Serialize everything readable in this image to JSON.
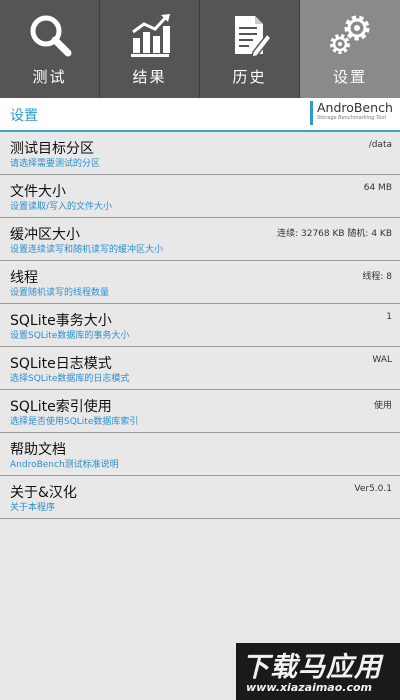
{
  "tabs": [
    {
      "label": "测试",
      "icon": "search-icon"
    },
    {
      "label": "结果",
      "icon": "bar-chart-icon"
    },
    {
      "label": "历史",
      "icon": "document-edit-icon"
    },
    {
      "label": "设置",
      "icon": "gear-icon",
      "active": true
    }
  ],
  "header": {
    "title": "设置",
    "logo_name": "AndroBench",
    "logo_tagline": "Storage Benchmarking Tool"
  },
  "settings": [
    {
      "title": "测试目标分区",
      "subtitle": "请选择需要测试的分区",
      "value": "/data"
    },
    {
      "title": "文件大小",
      "subtitle": "设置读取/写入的文件大小",
      "value": "64 MB"
    },
    {
      "title": "缓冲区大小",
      "subtitle": "设置连续读写和随机读写的缓冲区大小",
      "value": "连续: 32768 KB  随机: 4 KB"
    },
    {
      "title": "线程",
      "subtitle": "设置随机读写的线程数量",
      "value": "线程: 8"
    },
    {
      "title": "SQLite事务大小",
      "subtitle": "设置SQLite数据库的事务大小",
      "value": "1"
    },
    {
      "title": "SQLite日志模式",
      "subtitle": "选择SQLite数据库的日志模式",
      "value": "WAL"
    },
    {
      "title": "SQLite索引使用",
      "subtitle": "选择是否使用SQLite数据库索引",
      "value": "使用"
    },
    {
      "title": "帮助文档",
      "subtitle": "AndroBench测试标准说明",
      "value": ""
    },
    {
      "title": "关于&汉化",
      "subtitle": "关于本程序",
      "value": "Ver5.0.1"
    }
  ],
  "watermark": {
    "text": "下载马应用",
    "url": "www.xiazaimao.com"
  },
  "colors": {
    "accent": "#2b9ad6",
    "tabbar": "#555555",
    "tab_active": "#8a8a8a",
    "background": "#e8e8e8"
  }
}
